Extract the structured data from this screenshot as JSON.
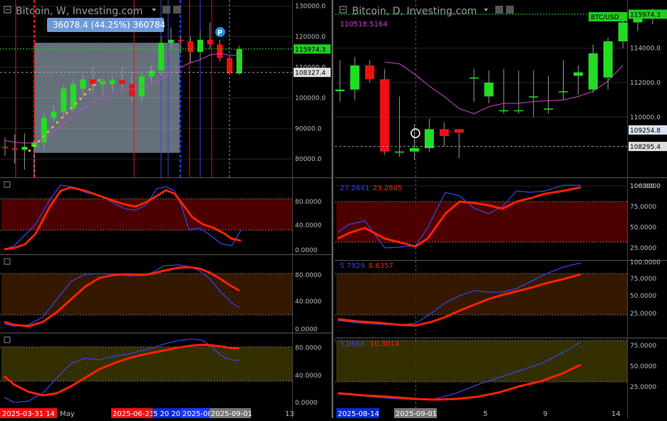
{
  "colors": {
    "up": "#22dd22",
    "down": "#ee1111",
    "ma": "#cc44cc",
    "k_line": "#3344dd",
    "d_line": "#ff2200",
    "grid": "#222",
    "price_line": "#22cc22",
    "selection": "#b9cce0"
  },
  "left": {
    "title": "Bitcoin, W, Investing.com",
    "title_icons": [
      "dropdown-icon",
      "settings-icon",
      "close-icon"
    ],
    "yaxis": {
      "min": 74000,
      "max": 132000,
      "ticks": [
        "130000.0",
        "120000.0",
        "110000.0",
        "100000.0",
        "90000.0",
        "80000.0"
      ],
      "tick_values": [
        130000,
        120000,
        110000,
        100000,
        90000,
        80000
      ]
    },
    "price_label": "115974.3",
    "price_value": 115974.3,
    "crosshair_label": "108327.4",
    "crosshair_value": 108327.4,
    "measure_tooltip": "36078.4 (44.25%) 360784",
    "measure_range": [
      82000,
      118000
    ],
    "marker": "P",
    "x_labels": [
      "2025-03-31 14",
      "May",
      "2025-06-23",
      "5 20 20",
      "2025-08",
      "2025-09-01",
      "13"
    ],
    "osc1_ticks": [
      "80.0000",
      "40.0000",
      "0.0000"
    ],
    "osc2_ticks": [
      "80.0000",
      "40.0000",
      "0.0000"
    ],
    "osc3_ticks": [
      "80.0000",
      "40.0000",
      "0.0000"
    ]
  },
  "right": {
    "title": "Bitcoin, D, Investing.com",
    "title_icons": [
      "dropdown-icon",
      "settings-icon",
      "close-icon"
    ],
    "yaxis": {
      "min": 106500,
      "max": 116800,
      "ticks": [
        "114000.0",
        "112000.0",
        "110000.0",
        "106000.0"
      ],
      "tick_values": [
        114000,
        112000,
        110000,
        106000
      ]
    },
    "ma_value": "110518.5164",
    "ticker_badge": "BTC/USD",
    "price_label": "115974.3",
    "price_value": 115974.3,
    "cross_label_1": "109254.8",
    "cross_value_1": 109254.8,
    "cross_label_2": "108295.4",
    "cross_value_2": 108295.4,
    "x_labels": [
      "2025-08-14",
      "2025-09-01",
      "5",
      "9",
      "14"
    ],
    "osc1_ticks": [
      "100.0000",
      "75.0000",
      "50.0000",
      "25.0000"
    ],
    "osc1_values": [
      "27.2641",
      "23.2805"
    ],
    "osc2_ticks": [
      "100.0000",
      "75.0000",
      "50.0000",
      "25.0000"
    ],
    "osc2_values": [
      "5.7929",
      "8.6357"
    ],
    "osc3_ticks": [
      "75.0000",
      "50.0000",
      "25.0000"
    ],
    "osc3_values": [
      "5.0668",
      "10.3014"
    ]
  },
  "chart_data": [
    {
      "type": "candlestick",
      "title": "Bitcoin, W, Investing.com",
      "x": [
        "2025-03-17",
        "2025-03-24",
        "2025-03-31",
        "2025-04-07",
        "2025-04-14",
        "2025-04-21",
        "2025-04-28",
        "2025-05-05",
        "2025-05-12",
        "2025-05-19",
        "2025-05-26",
        "2025-06-02",
        "2025-06-09",
        "2025-06-16",
        "2025-06-23",
        "2025-06-30",
        "2025-07-07",
        "2025-07-14",
        "2025-07-21",
        "2025-07-28",
        "2025-08-04",
        "2025-08-11",
        "2025-08-18",
        "2025-08-25",
        "2025-09-01"
      ],
      "open": [
        84000,
        83500,
        83000,
        84000,
        85500,
        93500,
        95500,
        96500,
        103000,
        106000,
        104500,
        104500,
        105800,
        104500,
        100500,
        107000,
        109000,
        118000,
        119000,
        118500,
        115000,
        119000,
        117500,
        113000,
        108000
      ],
      "close": [
        83500,
        83000,
        84000,
        85500,
        93500,
        95500,
        103000,
        104500,
        106000,
        104500,
        105500,
        105800,
        104500,
        100500,
        107000,
        109000,
        118000,
        119000,
        118500,
        115000,
        119000,
        117500,
        113000,
        108000,
        115974
      ],
      "high": [
        87000,
        88000,
        88500,
        86000,
        95000,
        97500,
        104000,
        106000,
        107500,
        110000,
        106500,
        107000,
        110000,
        108500,
        108000,
        110500,
        120000,
        123000,
        120000,
        120000,
        122000,
        124500,
        119000,
        113500,
        117000
      ],
      "low": [
        81000,
        78500,
        76500,
        74500,
        83000,
        92500,
        93500,
        95500,
        100500,
        101500,
        101000,
        102000,
        102500,
        99000,
        98500,
        105000,
        107000,
        116500,
        114500,
        111500,
        112000,
        116000,
        112000,
        107500,
        107500
      ],
      "ma": [
        86000,
        85500,
        85200,
        85300,
        86800,
        89000,
        91500,
        94000,
        96500,
        98500,
        100000,
        101500,
        102500,
        102800,
        103500,
        104500,
        106000,
        108000,
        110000,
        111500,
        112500,
        114000,
        114500,
        114000,
        113800
      ]
    },
    {
      "type": "candlestick",
      "title": "Bitcoin, D, Investing.com",
      "x": [
        "2025-08-24",
        "2025-08-25",
        "2025-08-26",
        "2025-08-27",
        "2025-08-28",
        "2025-08-29",
        "2025-08-30",
        "2025-08-31",
        "2025-09-01",
        "2025-09-02",
        "2025-09-03",
        "2025-09-04",
        "2025-09-05",
        "2025-09-06",
        "2025-09-07",
        "2025-09-08",
        "2025-09-09",
        "2025-09-10",
        "2025-09-11",
        "2025-09-12",
        "2025-09-13",
        "2025-09-14",
        "2025-09-15"
      ],
      "open": [
        111500,
        111600,
        113000,
        112200,
        108000,
        108000,
        108200,
        109300,
        109300,
        112300,
        111200,
        110400,
        110400,
        111200,
        110500,
        111500,
        112400,
        111600,
        112300,
        114400,
        115500,
        115900,
        116000
      ],
      "close": [
        111600,
        113000,
        112200,
        108000,
        108000,
        108200,
        109300,
        108900,
        109100,
        112300,
        112000,
        110400,
        110400,
        111200,
        110500,
        111500,
        112600,
        113700,
        114400,
        115500,
        115900,
        116000,
        116000
      ],
      "high": [
        113300,
        113500,
        113300,
        112800,
        111200,
        109600,
        109900,
        109700,
        109300,
        112800,
        112700,
        112800,
        112700,
        112700,
        112400,
        113300,
        113000,
        114200,
        114600,
        115600,
        116100,
        116300,
        116300
      ],
      "low": [
        110900,
        111000,
        112000,
        107800,
        107700,
        107500,
        108000,
        108300,
        107600,
        110900,
        110800,
        110200,
        110200,
        110000,
        110200,
        111000,
        111300,
        111400,
        111600,
        114000,
        115000,
        115400,
        115700
      ],
      "ma": [
        null,
        null,
        null,
        113200,
        113100,
        112500,
        111800,
        111200,
        110500,
        110200,
        110600,
        110800,
        110800,
        110900,
        110950,
        111000,
        111200,
        111500,
        112100,
        113000,
        null,
        null,
        null
      ]
    }
  ]
}
